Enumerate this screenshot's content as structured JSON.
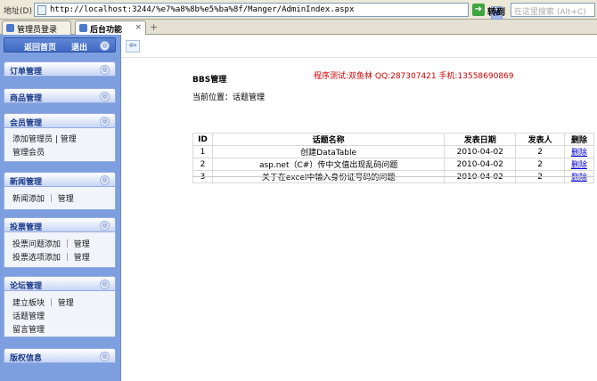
{
  "addressbar": {
    "label": "地址(D)",
    "url": "http://localhost:3244/%e7%a8%8b%e5%ba%8f/Manger/AdminIndex.aspx",
    "go_label": "转到",
    "search_placeholder": "在这里搜索 (Alt+C)"
  },
  "tabs": [
    {
      "label": "管理员登录"
    },
    {
      "label": "后台功能",
      "close": "×"
    }
  ],
  "newtab": "+",
  "sidebar": {
    "home": "返回首页",
    "exit": "退出",
    "sections": [
      {
        "title": "订单管理"
      },
      {
        "title": "商品管理"
      },
      {
        "title": "会员管理",
        "items": [
          "添加管理员 | 管理",
          "管理会员"
        ]
      },
      {
        "title": "新闻管理",
        "items": [
          "新闻添加 ｜ 管理"
        ]
      },
      {
        "title": "投票管理",
        "items": [
          "投票问题添加 ｜ 管理",
          "投票选项添加 ｜ 管理"
        ]
      },
      {
        "title": "论坛管理",
        "items": [
          "建立板块 ｜ 管理",
          "话题管理",
          "留言管理"
        ]
      },
      {
        "title": "版权信息"
      }
    ]
  },
  "main": {
    "back": "⇦",
    "title": "BBS管理",
    "test_info": "程序测试:双鱼林 QQ:287307421 手机:13558690869",
    "breadcrumb": "当前位置：话题管理",
    "table": {
      "headers": [
        "ID",
        "话题名称",
        "发表日期",
        "发表人",
        "删除"
      ],
      "rows": [
        [
          "1",
          "创建DataTable",
          "2010-04-02",
          "2",
          "删除"
        ],
        [
          "2",
          "asp.net（C#）传中文值出现乱码问题",
          "2010-04-02",
          "2",
          "删除"
        ],
        [
          "3",
          "关于在excel中输入身份证号码的问题",
          "2010-04-02",
          "2",
          "删除"
        ]
      ]
    }
  }
}
